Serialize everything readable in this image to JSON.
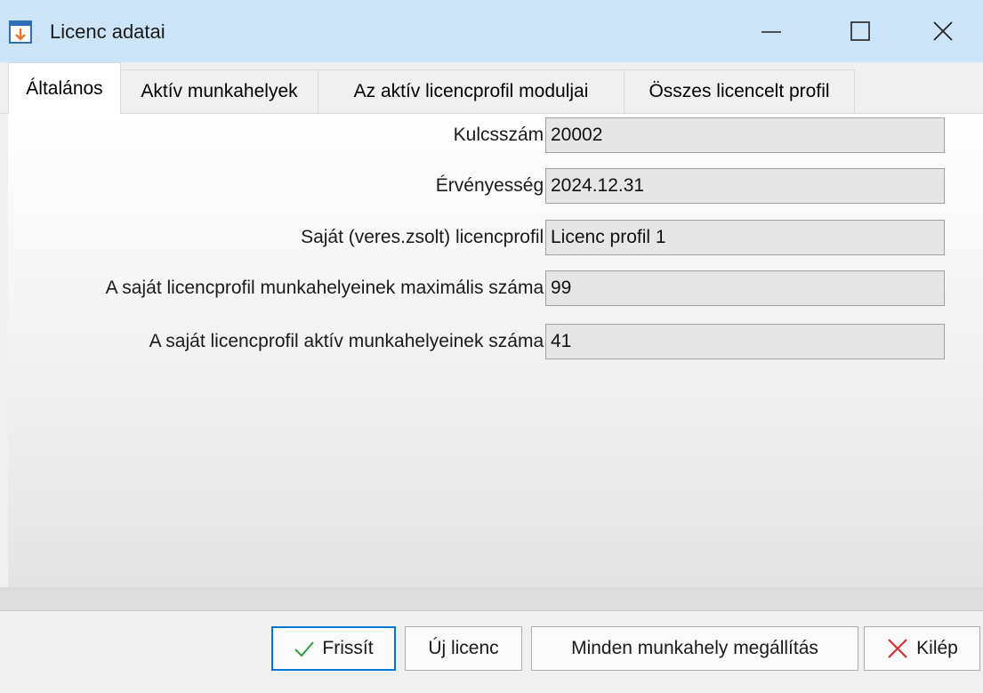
{
  "window": {
    "title": "Licenc adatai",
    "icon": "app-download-window-icon",
    "controls": [
      "minimize-icon",
      "maximize-icon",
      "close-icon"
    ]
  },
  "tabs": [
    {
      "label": "Általános",
      "active": true
    },
    {
      "label": "Aktív munkahelyek",
      "active": false
    },
    {
      "label": "Az aktív licencprofil moduljai",
      "active": false
    },
    {
      "label": "Összes licencelt profil",
      "active": false
    }
  ],
  "fields": [
    {
      "label": "Kulcsszám:",
      "value": "20002"
    },
    {
      "label": "Érvényesség:",
      "value": "2024.12.31"
    },
    {
      "label": "Saját (veres.zsolt) licencprofil:",
      "value": "Licenc profil 1"
    },
    {
      "label": "A saját licencprofil munkahelyeinek maximális száma:",
      "value": "99"
    },
    {
      "label": "A saját licencprofil aktív munkahelyeinek száma:",
      "value": "41"
    }
  ],
  "buttons": {
    "refresh": "Frissít",
    "new_license": "Új licenc",
    "stop_all": "Minden munkahely megállítás",
    "quit": "Kilép"
  },
  "colors": {
    "titlebar": "#cce4f7",
    "icon_orange": "#e8772e",
    "icon_blue": "#2e6fb7",
    "check_green": "#2e9e3e",
    "quit_red": "#d32f2f",
    "focus_blue": "#0078d7"
  }
}
